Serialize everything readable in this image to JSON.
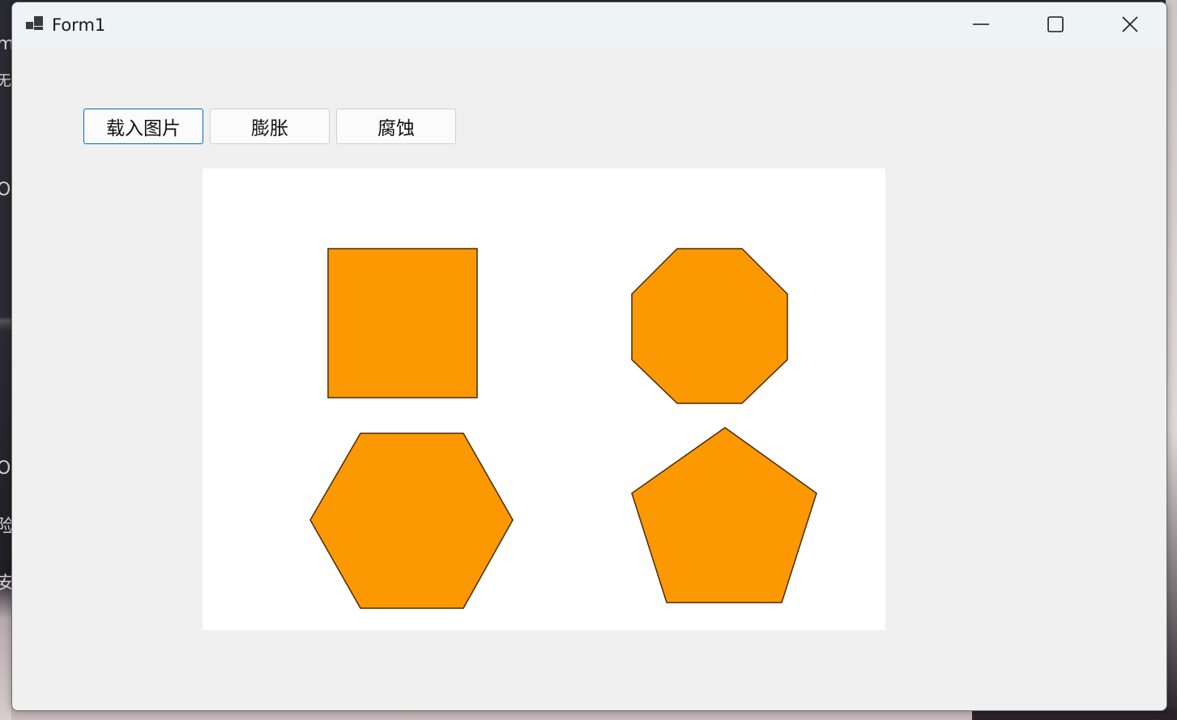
{
  "window": {
    "title": "Form1",
    "caption_buttons": [
      "minimize-icon",
      "maximize-icon",
      "close-icon"
    ]
  },
  "buttons": {
    "load_image": "载入图片",
    "dilate": "膨胀",
    "erode": "腐蚀"
  },
  "picture_box": {
    "content": "image of four polygons",
    "shapes": [
      "square",
      "octagon",
      "hexagon",
      "pentagon"
    ],
    "fill_color": "#FC9801",
    "stroke_color": "#4a2a10"
  },
  "background_fragments": [
    "m",
    "无",
    "O",
    "O",
    "险",
    "安"
  ],
  "colors": {
    "titlebar": "#eef3f6",
    "client": "#f0f0f0",
    "focus_border": "#0a67b3"
  }
}
